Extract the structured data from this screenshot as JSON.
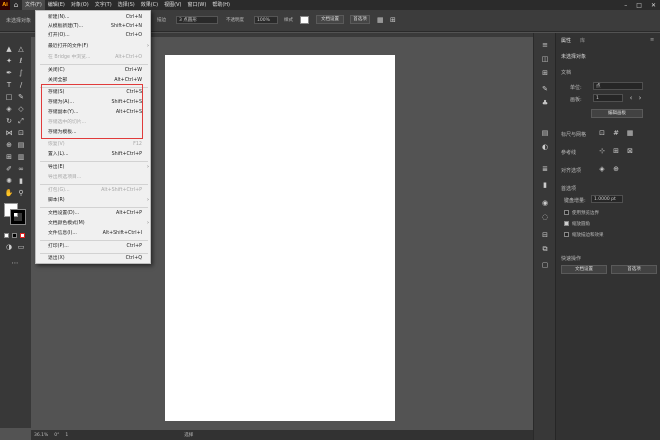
{
  "menubar": {
    "logo": "Ai",
    "items": [
      "文件(F)",
      "编辑(E)",
      "对象(O)",
      "文字(T)",
      "选择(S)",
      "效果(C)",
      "视图(V)",
      "窗口(W)",
      "帮助(H)"
    ]
  },
  "controlbar": {
    "selection": "未选择对象",
    "stroke_label": "描边",
    "brush": "3 点圆形",
    "opacity_label": "不透明度",
    "opacity_value": "100%",
    "style_label": "样式",
    "doc_setup": "文档设置",
    "prefs": "首选项"
  },
  "file_menu": {
    "items": [
      {
        "label": "新建(N)...",
        "shortcut": "Ctrl+N"
      },
      {
        "label": "从模板新建(T)...",
        "shortcut": "Shift+Ctrl+N"
      },
      {
        "label": "打开(O)...",
        "shortcut": "Ctrl+O"
      },
      {
        "label": "最近打开的文件(F)",
        "shortcut": "",
        "submenu": "›"
      },
      {
        "label": "在 Bridge 中浏览...",
        "shortcut": "Alt+Ctrl+O"
      },
      {
        "label": "关闭(C)",
        "shortcut": "Ctrl+W"
      },
      {
        "label": "关闭全部",
        "shortcut": "Alt+Ctrl+W"
      },
      {
        "label": "存储(S)",
        "shortcut": "Ctrl+S"
      },
      {
        "label": "存储为(A)...",
        "shortcut": "Shift+Ctrl+S"
      },
      {
        "label": "存储副本(Y)...",
        "shortcut": "Alt+Ctrl+S"
      },
      {
        "label": "存储选中的切片...",
        "shortcut": ""
      },
      {
        "label": "存储为模板...",
        "shortcut": ""
      },
      {
        "label": "恢复(V)",
        "shortcut": "F12"
      },
      {
        "label": "置入(L)...",
        "shortcut": "Shift+Ctrl+P"
      },
      {
        "label": "导出(E)",
        "shortcut": "",
        "submenu": "›"
      },
      {
        "label": "导出所选项目...",
        "shortcut": ""
      },
      {
        "label": "打包(G)...",
        "shortcut": "Alt+Shift+Ctrl+P"
      },
      {
        "label": "脚本(R)",
        "shortcut": "",
        "submenu": "›"
      },
      {
        "label": "文档设置(D)...",
        "shortcut": "Alt+Ctrl+P"
      },
      {
        "label": "文档颜色模式(M)",
        "shortcut": "",
        "submenu": "›"
      },
      {
        "label": "文件信息(I)...",
        "shortcut": "Alt+Shift+Ctrl+I"
      },
      {
        "label": "打印(P)...",
        "shortcut": "Ctrl+P"
      },
      {
        "label": "退出(X)",
        "shortcut": "Ctrl+Q"
      }
    ]
  },
  "properties": {
    "tab_properties": "属性",
    "tab_libraries": "库",
    "no_selection": "未选择对象",
    "doc_section": "文档",
    "unit_label": "单位:",
    "unit_value": "点",
    "artboard_label": "画板:",
    "artboard_value": "1",
    "edit_artboard": "编辑画板",
    "rulers_grids": "标尺与网格",
    "guides": "参考线",
    "snap": "对齐选项",
    "preferences": "首选项",
    "keyboard_increment_label": "键盘增量:",
    "keyboard_increment_value": "1.0000 pt",
    "check_preview_bounds": "使用预览边界",
    "check_scale_corners": "缩放圆角",
    "check_scale_strokes": "缩放描边和效果",
    "quick_actions": "快速操作",
    "doc_setup_btn": "文档设置",
    "prefs_btn": "首选项"
  },
  "status": {
    "zoom": "36.1%",
    "angle": "0°",
    "artboard": "1",
    "tool": "选择"
  }
}
